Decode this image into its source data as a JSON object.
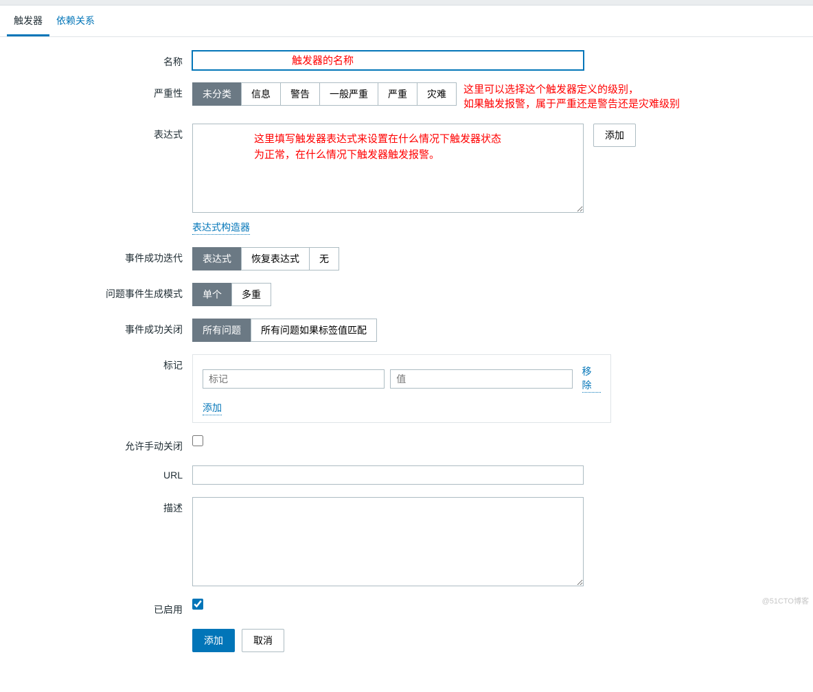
{
  "tabs": {
    "triggers": "触发器",
    "dependencies": "依赖关系"
  },
  "labels": {
    "name": "名称",
    "severity": "严重性",
    "expression": "表达式",
    "event_ok": "事件成功迭代",
    "problem_mode": "问题事件生成模式",
    "ok_close": "事件成功关闭",
    "tags": "标记",
    "manual_close": "允许手动关闭",
    "url": "URL",
    "description": "描述",
    "enabled": "已启用"
  },
  "severity": {
    "opts": [
      "未分类",
      "信息",
      "警告",
      "一般严重",
      "严重",
      "灾难"
    ],
    "active": 0
  },
  "event_ok": {
    "opts": [
      "表达式",
      "恢复表达式",
      "无"
    ],
    "active": 0
  },
  "problem_mode": {
    "opts": [
      "单个",
      "多重"
    ],
    "active": 0
  },
  "ok_close": {
    "opts": [
      "所有问题",
      "所有问题如果标签值匹配"
    ],
    "active": 0
  },
  "buttons": {
    "add": "添加",
    "cancel": "取消",
    "remove": "移除",
    "add_tag": "添加"
  },
  "links": {
    "expr_builder": "表达式构造器"
  },
  "placeholders": {
    "tag_name": "标记",
    "tag_value": "值"
  },
  "annotations": {
    "name": "触发器的名称",
    "severity_l1": "这里可以选择这个触发器定义的级别，",
    "severity_l2": "如果触发报警，属于严重还是警告还是灾难级别",
    "expr_l1": "这里填写触发器表达式来设置在什么情况下触发器状态",
    "expr_l2": "为正常，在什么情况下触发器触发报警。"
  },
  "watermark": "@51CTO博客"
}
